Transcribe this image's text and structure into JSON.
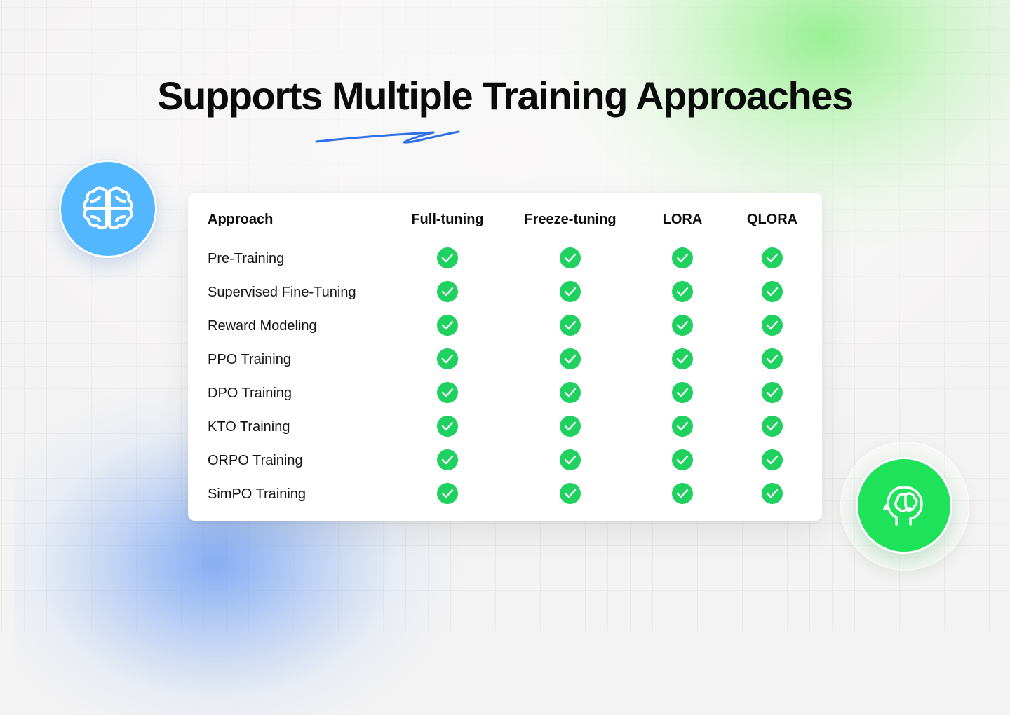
{
  "title": "Supports Multiple Training Approaches",
  "colors": {
    "accent_blue": "#52b7ff",
    "accent_green": "#1ee35a",
    "check_green": "#1fd15f",
    "underline_blue": "#2f6fe8"
  },
  "icons": {
    "left_badge": "brain-icon",
    "right_badge": "head-brain-icon",
    "cell": "check-circle-icon"
  },
  "table": {
    "headers": [
      "Approach",
      "Full-tuning",
      "Freeze-tuning",
      "LORA",
      "QLORA"
    ],
    "rows": [
      {
        "label": "Pre-Training",
        "supported": [
          true,
          true,
          true,
          true
        ]
      },
      {
        "label": "Supervised Fine-Tuning",
        "supported": [
          true,
          true,
          true,
          true
        ]
      },
      {
        "label": "Reward Modeling",
        "supported": [
          true,
          true,
          true,
          true
        ]
      },
      {
        "label": "PPO Training",
        "supported": [
          true,
          true,
          true,
          true
        ]
      },
      {
        "label": "DPO Training",
        "supported": [
          true,
          true,
          true,
          true
        ]
      },
      {
        "label": "KTO Training",
        "supported": [
          true,
          true,
          true,
          true
        ]
      },
      {
        "label": "ORPO Training",
        "supported": [
          true,
          true,
          true,
          true
        ]
      },
      {
        "label": "SimPO Training",
        "supported": [
          true,
          true,
          true,
          true
        ]
      }
    ]
  }
}
